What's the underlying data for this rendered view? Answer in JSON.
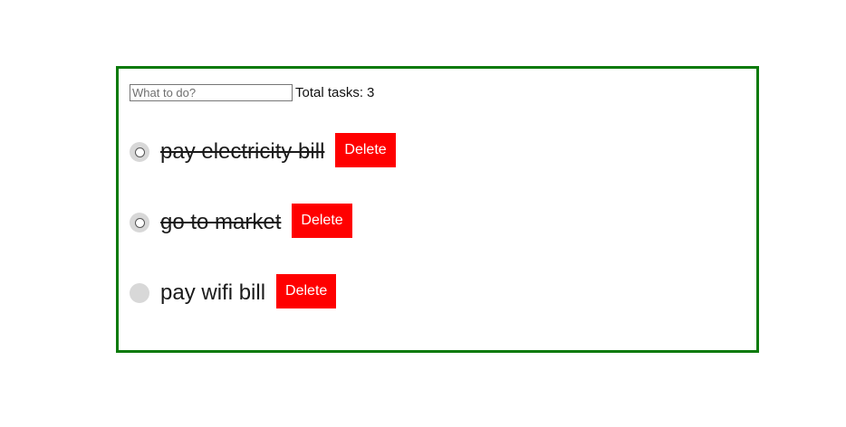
{
  "input": {
    "placeholder": "What to do?",
    "value": ""
  },
  "total": {
    "label": "Total tasks:",
    "count": "3"
  },
  "tasks": [
    {
      "text": "pay electricity bill",
      "completed": true,
      "delete_label": "Delete"
    },
    {
      "text": "go to market",
      "completed": true,
      "delete_label": "Delete"
    },
    {
      "text": "pay wifi bill",
      "completed": false,
      "delete_label": "Delete"
    }
  ],
  "colors": {
    "border": "#0b7a0b",
    "delete_bg": "#ff0000",
    "toggle_bg": "#d8d8d8"
  },
  "icons": {
    "completed_toggle": "radio-icon",
    "incomplete_toggle": "circle-icon"
  }
}
